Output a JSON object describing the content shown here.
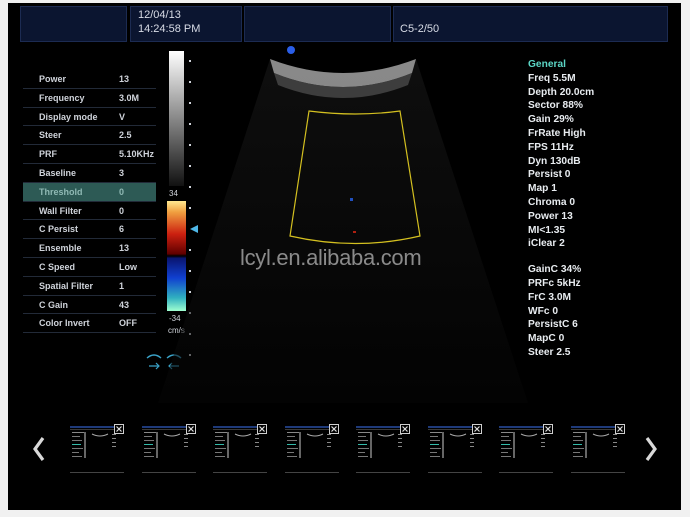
{
  "header": {
    "date": "12/04/13",
    "time": "14:24:58 PM",
    "probe": "C5-2/50"
  },
  "menu": {
    "items": [
      {
        "label": "Power",
        "value": "13"
      },
      {
        "label": "Frequency",
        "value": "3.0M"
      },
      {
        "label": "Display mode",
        "value": "V"
      },
      {
        "label": "Steer",
        "value": "2.5"
      },
      {
        "label": "PRF",
        "value": "5.10KHz"
      },
      {
        "label": "Baseline",
        "value": "3"
      },
      {
        "label": "Threshold",
        "value": "0",
        "selected": true
      },
      {
        "label": "Wall Filter",
        "value": "0"
      },
      {
        "label": "C Persist",
        "value": "6"
      },
      {
        "label": "Ensemble",
        "value": "13"
      },
      {
        "label": "C Speed",
        "value": "Low"
      },
      {
        "label": "Spatial Filter",
        "value": "1"
      },
      {
        "label": "C Gain",
        "value": "43"
      },
      {
        "label": "Color Invert",
        "value": "OFF"
      }
    ]
  },
  "colorscale": {
    "max": "34",
    "min": "-34",
    "unit": "cm/s"
  },
  "params": {
    "general_title": "General",
    "general": [
      "Freq 5.5M",
      "Depth 20.0cm",
      "Sector 88%",
      "Gain 29%",
      "FrRate High",
      "FPS 11Hz",
      "Dyn 130dB",
      "Persist 0",
      "Map 1",
      "Chroma 0",
      "Power 13",
      "MI<1.35",
      "iClear 2"
    ],
    "color": [
      "GainC 34%",
      "PRFc 5kHz",
      "FrC 3.0M",
      "WFc 0",
      "PersistC 6",
      "MapC 0",
      "Steer 2.5"
    ]
  },
  "watermark": "lcyl.en.alibaba.com",
  "thumbnails": {
    "count": 8,
    "prev_icon": "chevron-left-icon",
    "next_icon": "chevron-right-icon",
    "close_icon": "close-icon"
  },
  "colors": {
    "roi_outline": "#d4c020",
    "selected_row": "#2d5a55",
    "header_bg": "#0b1530",
    "accent_text": "#5cd6c6"
  }
}
